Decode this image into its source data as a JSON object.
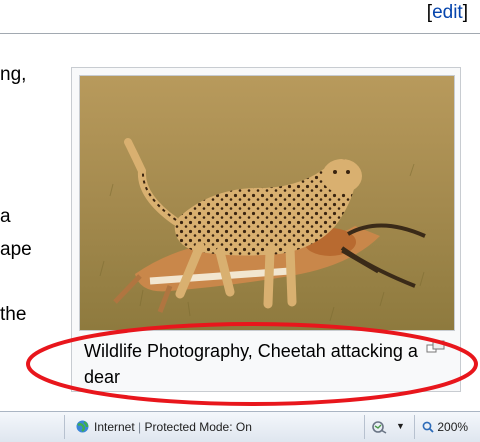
{
  "header": {
    "edit_open": "[",
    "edit_label": "edit",
    "edit_close": "]"
  },
  "article": {
    "line1": "ng,",
    "line2": "a",
    "line3": "ape",
    "line4": "the"
  },
  "figure": {
    "caption": "Wildlife Photography, Cheetah attacking a dear",
    "image_subject": "cheetah attacking gazelle"
  },
  "statusbar": {
    "zone_label": "Internet",
    "zone_separator": "|",
    "protected_mode": "Protected Mode: On",
    "zoom": "200%"
  },
  "colors": {
    "link": "#0645ad",
    "annotation": "#e8161c"
  }
}
